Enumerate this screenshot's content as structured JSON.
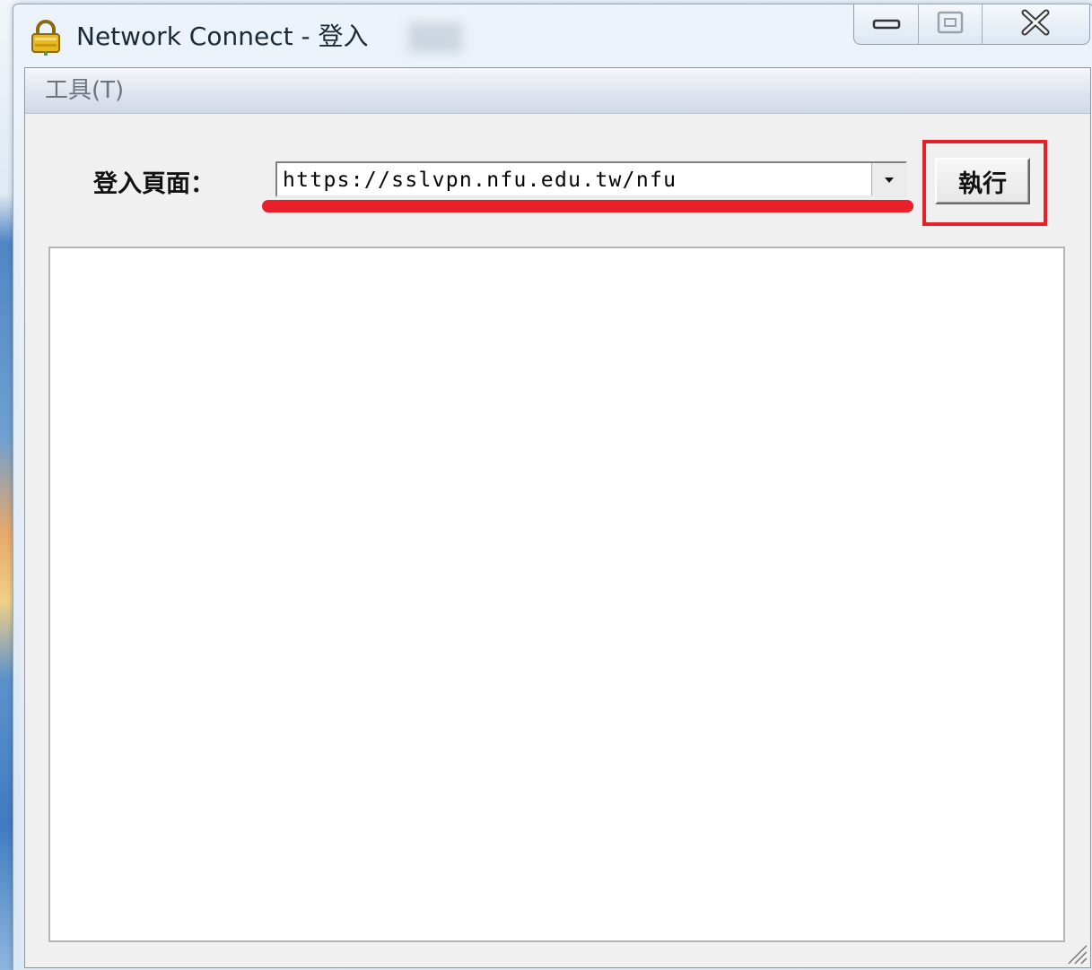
{
  "window": {
    "title": "Network Connect - 登入",
    "icon": "lock-icon",
    "caption_buttons": [
      "minimize-icon",
      "maximize-icon",
      "close-icon"
    ]
  },
  "menubar": {
    "items": [
      {
        "label": "工具(T)"
      }
    ]
  },
  "login": {
    "label": "登入頁面：",
    "url_value": "https://sslvpn.nfu.edu.tw/nfu",
    "dropdown_icon": "chevron-down-icon",
    "execute_label": "執行"
  },
  "annotations": {
    "highlight_color": "#e8202a"
  }
}
